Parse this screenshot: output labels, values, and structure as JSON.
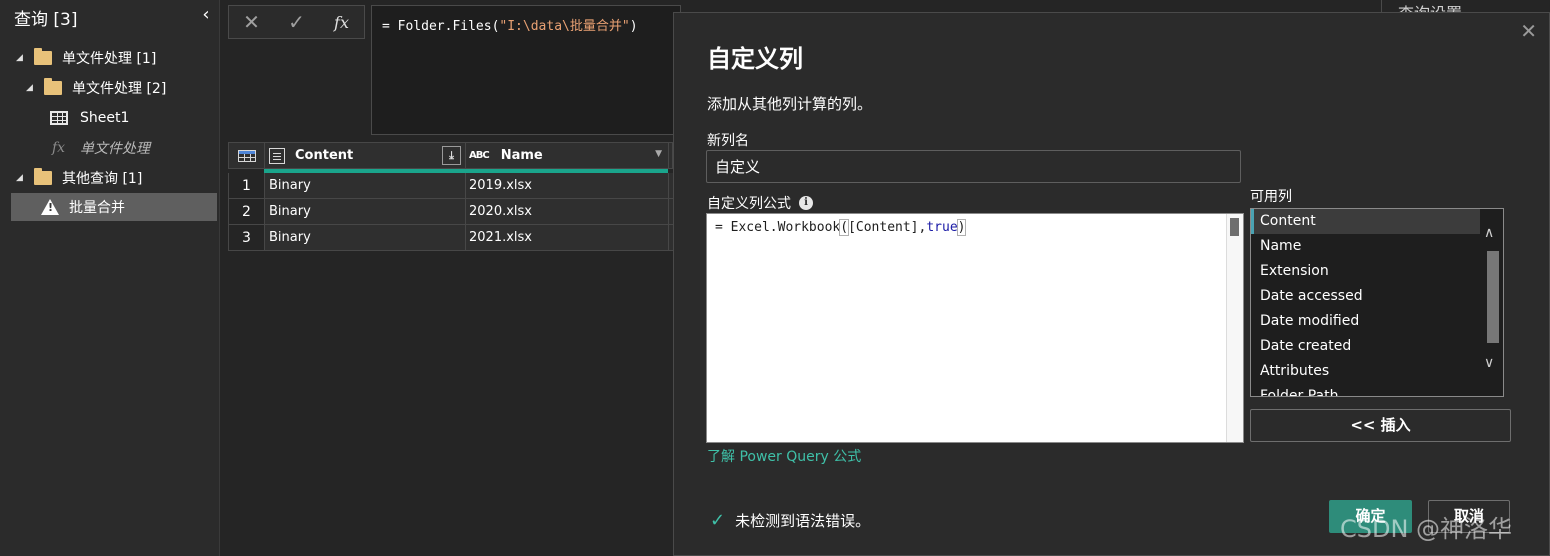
{
  "queries_pane": {
    "title": "查询 [3]",
    "collapse_icon": "chevron-left-icon",
    "tree": {
      "group1": "单文件处理 [1]",
      "group1_sub": "单文件处理 [2]",
      "sheet1": "Sheet1",
      "function": "单文件处理",
      "group2": "其他查询 [1]",
      "selected": "批量合并"
    }
  },
  "formula_bar": {
    "cancel_icon": "close-icon",
    "commit_icon": "check-icon",
    "fx_label": "fx",
    "formula_prefix": "= Folder.Files(",
    "formula_string": "\"I:\\data\\批量合并\"",
    "formula_suffix": ")"
  },
  "grid": {
    "columns": [
      "Content",
      "Name"
    ],
    "abc_label": "ABC",
    "rows": [
      {
        "n": "1",
        "content": "Binary",
        "name": "2019.xlsx"
      },
      {
        "n": "2",
        "content": "Binary",
        "name": "2020.xlsx"
      },
      {
        "n": "3",
        "content": "Binary",
        "name": "2021.xlsx"
      }
    ],
    "column_quality_color": "#1aa58c"
  },
  "settings_peek": "查询设置",
  "dialog": {
    "title": "自定义列",
    "description": "添加从其他列计算的列。",
    "new_name_label": "新列名",
    "new_name_value": "自定义",
    "formula_label": "自定义列公式",
    "formula_parts": {
      "prefix": "= Excel.Workbook",
      "open_paren": "(",
      "args": "[Content],",
      "keyword": "true",
      "close_paren": ")"
    },
    "available_label": "可用列",
    "available_columns": [
      "Content",
      "Name",
      "Extension",
      "Date accessed",
      "Date modified",
      "Date created",
      "Attributes",
      "Folder Path"
    ],
    "insert_label": "<< 插入",
    "learn_link": "了解 Power Query 公式",
    "status": "未检测到语法错误。",
    "ok_label": "确定",
    "cancel_label": "取消",
    "accent_color": "#2e8c7a"
  },
  "watermark": "CSDN @神洛华"
}
